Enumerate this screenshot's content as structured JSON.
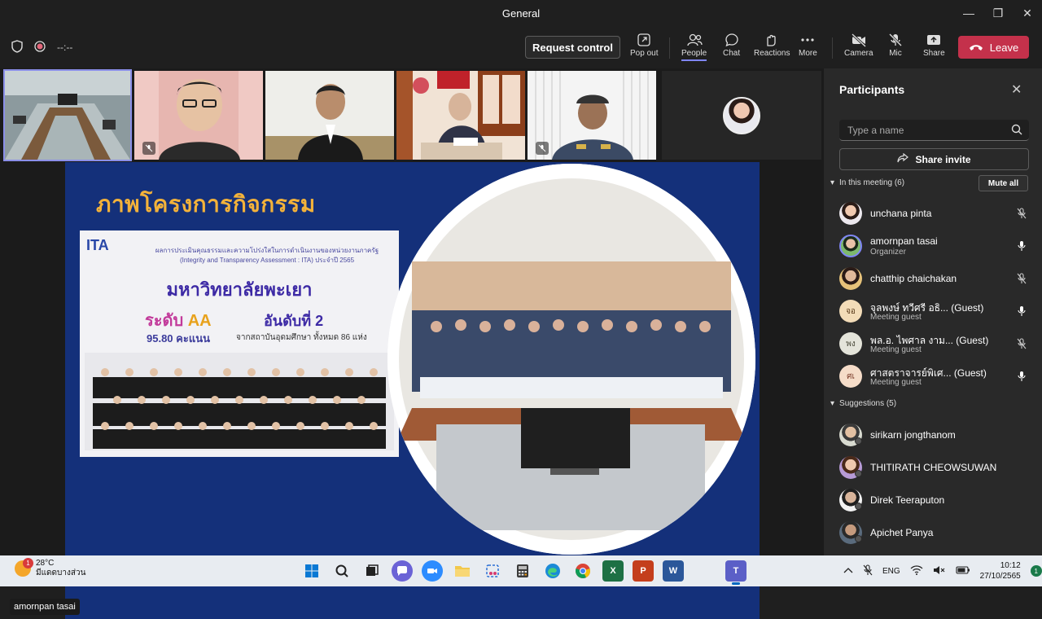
{
  "window": {
    "title": "General",
    "controls": [
      "minimize",
      "maximize",
      "close"
    ]
  },
  "toolbar": {
    "timer": "--:--",
    "request_control": "Request control",
    "items": [
      {
        "label": "Pop out",
        "icon": "pop-out-icon"
      },
      {
        "label": "People",
        "icon": "people-icon",
        "active": true
      },
      {
        "label": "Chat",
        "icon": "chat-icon"
      },
      {
        "label": "Reactions",
        "icon": "reactions-icon"
      },
      {
        "label": "More",
        "icon": "more-icon"
      },
      {
        "label": "Camera",
        "icon": "camera-off-icon"
      },
      {
        "label": "Mic",
        "icon": "mic-off-icon"
      },
      {
        "label": "Share",
        "icon": "share-icon"
      }
    ],
    "leave": "Leave",
    "leave_color": "#c4314b"
  },
  "stage": {
    "speaker_name": "amornpan tasai"
  },
  "slide": {
    "title": "ภาพโครงการกิจกรรม",
    "ita_logo": "ITA",
    "ita_line1": "ผลการประเมินคุณธรรมและความโปร่งใสในการดำเนินงานของหน่วยงานภาครัฐ",
    "ita_line2": "(Integrity and Transparency Assessment : ITA) ประจำปี 2565",
    "university": "มหาวิทยาลัยพะเยา",
    "level_prefix": "ระดับ",
    "level": "AA",
    "score": "95.80 คะแนน",
    "rank": "อันดับที่ 2",
    "rank_sub": "จากสถาบันอุดมศึกษา ทั้งหมด 86 แห่ง"
  },
  "panel": {
    "title": "Participants",
    "search_placeholder": "Type a name",
    "share_invite": "Share invite",
    "in_meeting_label": "In this meeting (6)",
    "mute_all": "Mute all",
    "suggestions_label": "Suggestions (5)",
    "participants": [
      {
        "name": "unchana pinta",
        "sub": "",
        "mic": "off",
        "initials": ""
      },
      {
        "name": "amornpan tasai",
        "sub": "Organizer",
        "mic": "on",
        "initials": ""
      },
      {
        "name": "chatthip chaichakan",
        "sub": "",
        "mic": "off",
        "initials": ""
      },
      {
        "name": "จุลพงษ์ ทวีศรี อธิ...  (Guest)",
        "sub": "Meeting guest",
        "mic": "on",
        "initials": "จอ"
      },
      {
        "name": "พล.อ. ไพศาล งาม...  (Guest)",
        "sub": "Meeting guest",
        "mic": "off",
        "initials": "พง"
      },
      {
        "name": "ศาสตราจารย์พิเศ...  (Guest)",
        "sub": "Meeting guest",
        "mic": "on",
        "initials": "ศเ"
      }
    ],
    "suggestions": [
      {
        "name": "sirikarn jongthanom"
      },
      {
        "name": "THITIRATH CHEOWSUWAN"
      },
      {
        "name": "Direk Teeraputon"
      },
      {
        "name": "Apichet Panya"
      }
    ]
  },
  "taskbar": {
    "weather_temp": "28°C",
    "weather_desc": "มีแดดบางส่วน",
    "weather_badge": "1",
    "apps": [
      "start-icon",
      "search-icon",
      "task-view-icon",
      "teams-chat-icon",
      "zoom-icon",
      "file-explorer-icon",
      "snipping-tool-icon",
      "calculator-icon",
      "edge-icon",
      "chrome-icon",
      "excel-icon",
      "powerpoint-icon",
      "word-icon",
      "teams-icon"
    ],
    "language": "ENG",
    "time": "10:12",
    "date": "27/10/2565",
    "notification_count": "1"
  }
}
